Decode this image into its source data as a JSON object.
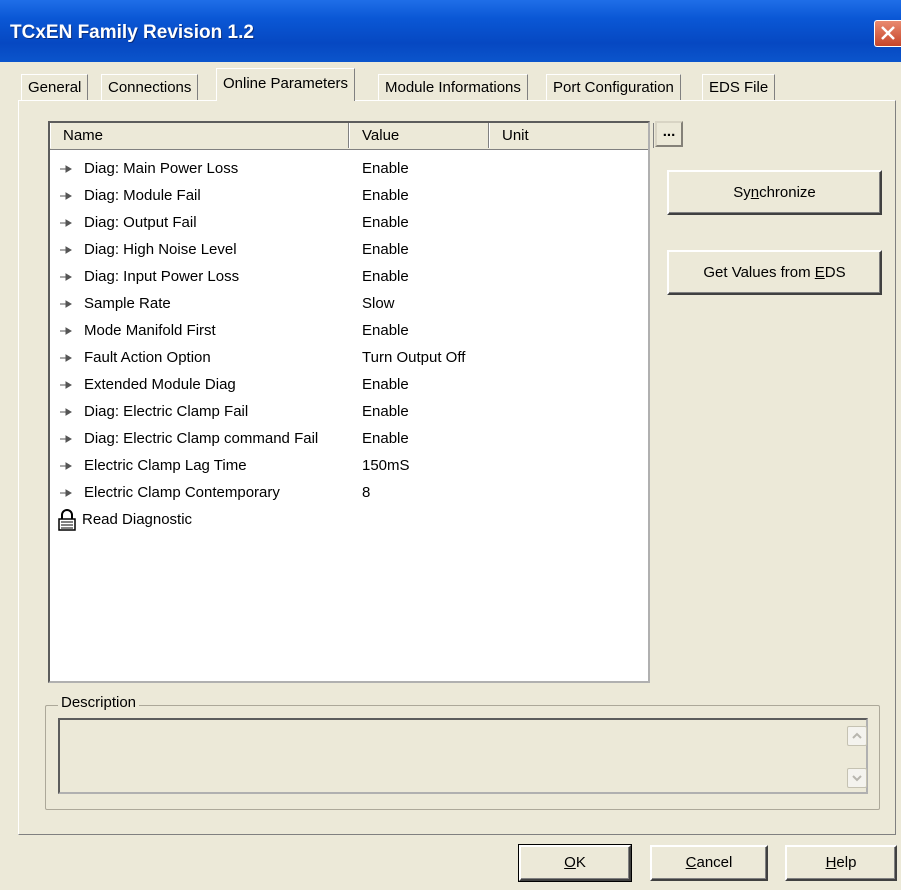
{
  "window": {
    "title": "TCxEN Family Revision 1.2"
  },
  "tabs": [
    "General",
    "Connections",
    "Online Parameters",
    "Module Informations",
    "Port Configuration",
    "EDS File"
  ],
  "active_tab": "Online Parameters",
  "listview": {
    "columns": [
      "Name",
      "Value",
      "Unit"
    ],
    "rows": [
      {
        "name": "Diag: Main Power Loss",
        "value": "Enable"
      },
      {
        "name": "Diag: Module Fail",
        "value": "Enable"
      },
      {
        "name": "Diag: Output Fail",
        "value": "Enable"
      },
      {
        "name": "Diag: High Noise Level",
        "value": "Enable"
      },
      {
        "name": "Diag: Input Power Loss",
        "value": "Enable"
      },
      {
        "name": "Sample Rate",
        "value": "Slow"
      },
      {
        "name": "Mode Manifold First",
        "value": "Enable"
      },
      {
        "name": "Fault Action Option",
        "value": "Turn Output Off"
      },
      {
        "name": "Extended Module Diag",
        "value": "Enable"
      },
      {
        "name": "Diag: Electric Clamp Fail",
        "value": "Enable"
      },
      {
        "name": "Diag: Electric Clamp command Fail",
        "value": "Enable"
      },
      {
        "name": "Electric Clamp Lag Time",
        "value": "150mS"
      },
      {
        "name": "Electric Clamp Contemporary",
        "value": "8"
      }
    ],
    "locked_item": "Read Diagnostic",
    "row_icon": "arrow-right-icon",
    "locked_icon": "lock-icon"
  },
  "buttons": {
    "dots": "...",
    "sync_pre": "Sy",
    "sync_key": "n",
    "sync_post": "chronize",
    "eds_pre": "Get Values from ",
    "eds_key": "E",
    "eds_post": "DS",
    "ok_key": "O",
    "ok_post": "K",
    "cancel_key": "C",
    "cancel_post": "ancel",
    "help_key": "H",
    "help_post": "elp"
  },
  "description": {
    "label": "Description",
    "text": ""
  },
  "colors": {
    "titlebar": "#0a57d5",
    "face": "#ece9d8",
    "close": "#c6452b"
  }
}
